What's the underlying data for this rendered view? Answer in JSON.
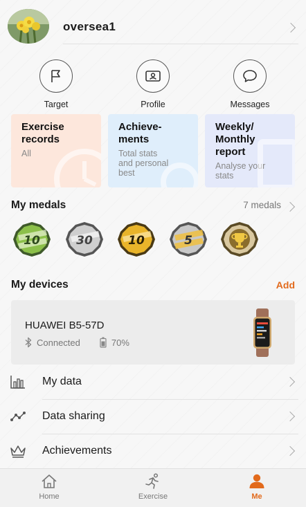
{
  "profile": {
    "username": "oversea1"
  },
  "shortcuts": [
    {
      "label": "Target",
      "icon": "flag-icon"
    },
    {
      "label": "Profile",
      "icon": "id-card-icon"
    },
    {
      "label": "Messages",
      "icon": "chat-bubble-icon"
    }
  ],
  "cards": [
    {
      "title": "Exercise\nrecords",
      "subtitle": "All",
      "bg": "#fde7dc"
    },
    {
      "title": "Achieve-\nments",
      "subtitle": "Total stats\nand personal\nbest",
      "bg": "#dfeefb"
    },
    {
      "title": "Weekly/\nMonthly\nreport",
      "subtitle": "Analyse your\nstats",
      "bg": "#e4e9fa"
    }
  ],
  "medals": {
    "title": "My medals",
    "count": "7 medals",
    "items": [
      {
        "label": "10",
        "scheme": "green"
      },
      {
        "label": "30",
        "scheme": "silver"
      },
      {
        "label": "10",
        "scheme": "gold"
      },
      {
        "label": "5",
        "scheme": "silver-gold"
      },
      {
        "label": "",
        "scheme": "trophy"
      }
    ]
  },
  "devices": {
    "title": "My devices",
    "add": "Add",
    "device": {
      "name": "HUAWEI B5-57D",
      "status": "Connected",
      "battery": "70%"
    }
  },
  "menu": [
    {
      "label": "My data",
      "icon": "bar-chart-icon"
    },
    {
      "label": "Data sharing",
      "icon": "share-line-icon"
    },
    {
      "label": "Achievements",
      "icon": "crown-icon"
    }
  ],
  "nav": [
    {
      "label": "Home",
      "icon": "home-icon",
      "active": false
    },
    {
      "label": "Exercise",
      "icon": "running-icon",
      "active": false
    },
    {
      "label": "Me",
      "icon": "person-icon",
      "active": true
    }
  ],
  "colors": {
    "accent": "#e26a1c"
  }
}
